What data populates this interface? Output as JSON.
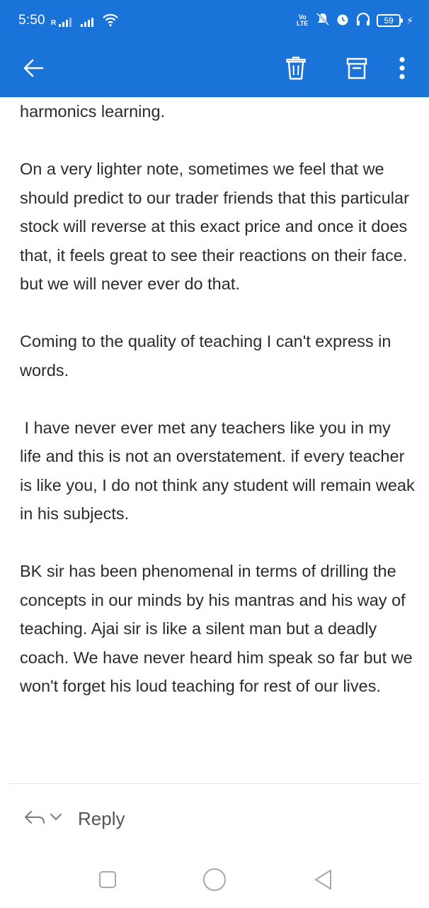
{
  "status_bar": {
    "time": "5:50",
    "signal_label": "R",
    "volte": "Vo LTE",
    "battery_level": "59"
  },
  "app_bar": {
    "accent_color": "#1a73d9",
    "icons": [
      "back-arrow-icon",
      "delete-icon",
      "archive-icon",
      "more-vert-icon"
    ]
  },
  "message": {
    "paragraphs": [
      "harmonics learning.",
      "On a very lighter note, sometimes we feel that we should predict to our trader friends that this particular stock will reverse at this exact price and once it does that,  it feels great to see their reactions on their face. but we will never ever do that.",
      "Coming to the quality of teaching I can't express in words.",
      " I have never ever met any teachers like you in my life and this is not an overstatement. if every teacher is like you, I do not think any student will remain weak in his subjects.",
      "BK sir has been phenomenal in terms of drilling the concepts in our minds by his mantras and his way of teaching. Ajai sir is like a silent man but a deadly coach. We have never heard him speak so far but we won't forget his loud teaching for rest of our lives."
    ]
  },
  "reply": {
    "label": "Reply"
  },
  "nav_bar": {
    "icons": [
      "recents-square-icon",
      "home-circle-icon",
      "back-triangle-icon"
    ]
  }
}
